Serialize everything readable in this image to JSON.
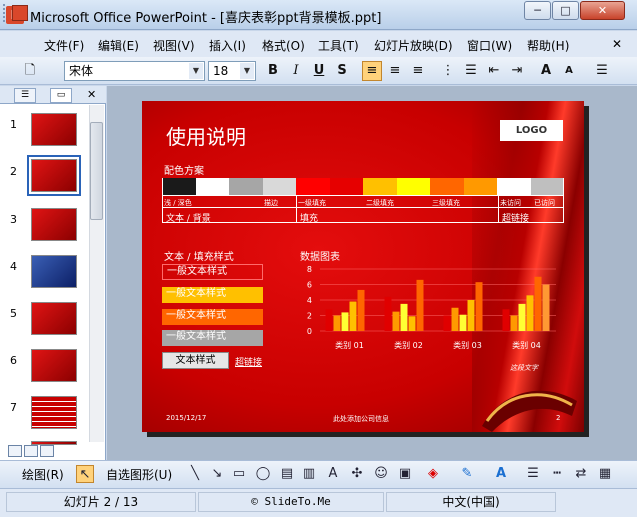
{
  "window": {
    "title": "Microsoft Office PowerPoint - [喜庆表彰ppt背景模板.ppt]",
    "min_glyph": "─",
    "max_glyph": "□",
    "close_glyph": "✕"
  },
  "menu": {
    "items": [
      "文件(F)",
      "编辑(E)",
      "视图(V)",
      "插入(I)",
      "格式(O)",
      "工具(T)",
      "幻灯片放映(D)",
      "窗口(W)",
      "帮助(H)"
    ],
    "close_glyph": "✕"
  },
  "toolbar": {
    "font": "宋体",
    "size": "18",
    "bold": "B",
    "italic": "I",
    "underline": "U",
    "shadow": "S",
    "grow_font": "A",
    "shrink_font": "A"
  },
  "slides_panel": {
    "numbers": [
      "1",
      "2",
      "3",
      "4",
      "5",
      "6",
      "7"
    ],
    "selected": 2,
    "close_glyph": "✕"
  },
  "slide": {
    "title": "使用说明",
    "logo": "LOGO",
    "scheme_label": "配色方案",
    "swatch_colors": [
      "#1a1a1a",
      "#ffffff",
      "#a6a6a6",
      "#d9d9d9",
      "#ff0000",
      "#e60000",
      "#ffc000",
      "#ffff00",
      "#ff6600",
      "#ff9900",
      "#ffffff",
      "#bfbfbf"
    ],
    "swatch_labels": [
      "浅 / 深色",
      "描边",
      "一级填充",
      "二级填充",
      "三级填充",
      "未访问",
      "已访问"
    ],
    "row2": [
      "文本 / 背景",
      "填充",
      "超链接"
    ],
    "text_style_label": "文本 / 填充样式",
    "styles": [
      "一般文本样式",
      "一般文本样式",
      "一般文本样式",
      "一般文本样式"
    ],
    "text_style_btn": "文本样式",
    "hyperlink": "超链接",
    "chart_label": "数据图表",
    "footer_date": "2015/12/17",
    "footer_company": "此处添加公司信息",
    "page": "2",
    "note": "这段文字"
  },
  "chart_data": {
    "type": "bar",
    "categories": [
      "类别 01",
      "类别 02",
      "类别 03",
      "类别 04"
    ],
    "series": [
      {
        "color": "#e00000",
        "values": [
          2.8,
          4.4,
          2.0,
          2.8
        ]
      },
      {
        "color": "#ff9900",
        "values": [
          2.0,
          2.5,
          3.0,
          2.0
        ]
      },
      {
        "color": "#ffff33",
        "values": [
          2.4,
          3.5,
          2.1,
          3.5
        ]
      },
      {
        "color": "#ffc000",
        "values": [
          3.8,
          1.9,
          4.0,
          4.6
        ]
      },
      {
        "color": "#ff6600",
        "values": [
          5.3,
          6.6,
          6.3,
          7.0
        ]
      },
      {
        "color": "#ff9933",
        "values": [
          0,
          0,
          0,
          6.0
        ]
      }
    ],
    "ylim": [
      0,
      8
    ],
    "yticks": [
      "8",
      "6",
      "4",
      "2",
      "0"
    ]
  },
  "drawbar": {
    "draw": "绘图(R)",
    "autoshapes": "自选图形(U)"
  },
  "status": {
    "slide": "幻灯片 2 / 13",
    "template": "© SlideTo.Me",
    "lang": "中文(中国)"
  }
}
